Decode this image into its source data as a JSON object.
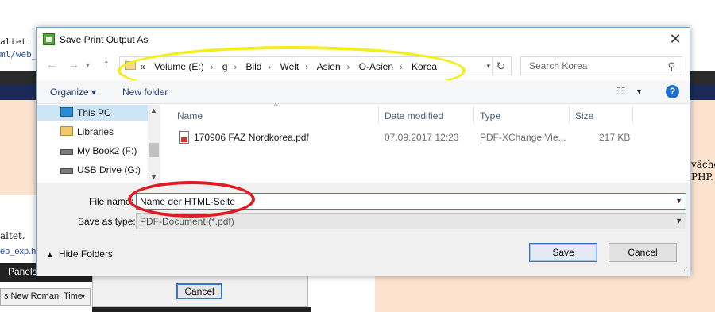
{
  "background": {
    "code_line1": "altet.",
    "code_line2": "ml/web_",
    "right_text1": "väche",
    "right_text2": "PHP.",
    "left_text1": "altet.",
    "left_text2": "eb_exp.ht",
    "panels_label": "Panels",
    "font_value": "s New Roman, Time",
    "cancel_label": "Cancel"
  },
  "dialog": {
    "title": "Save Print Output As",
    "close_glyph": "✕",
    "address": {
      "crumbs": [
        "«",
        "Volume (E:)",
        "g",
        "Bild",
        "Welt",
        "Asien",
        "O-Asien",
        "Korea"
      ]
    },
    "search": {
      "placeholder": "Search Korea"
    },
    "toolbar": {
      "organize": "Organize ▾",
      "new_folder": "New folder",
      "help": "?"
    },
    "nav_pane": {
      "items": [
        {
          "label": "This PC",
          "icon": "computer-icon"
        },
        {
          "label": "Libraries",
          "icon": "library-icon"
        },
        {
          "label": "My Book2 (F:)",
          "icon": "drive-icon"
        },
        {
          "label": "USB Drive (G:)",
          "icon": "usb-drive-icon"
        }
      ]
    },
    "file_list": {
      "columns": [
        "Name",
        "Date modified",
        "Type",
        "Size"
      ],
      "rows": [
        {
          "name": "170906 FAZ Nordkorea.pdf",
          "date": "07.09.2017 12:23",
          "type": "PDF-XChange Vie...",
          "size": "217 KB",
          "icon": "pdf-file-icon"
        }
      ]
    },
    "file_name": {
      "label": "File name:",
      "value": "Name der HTML-Seite"
    },
    "save_as_type": {
      "label": "Save as type:",
      "value": "PDF-Document (*.pdf)"
    },
    "hide_folders": "Hide Folders",
    "save_button": "Save",
    "cancel_button": "Cancel"
  },
  "annotations": {
    "highlight_colors": {
      "yellow": "#f2ef1d",
      "red": "#e01b22"
    }
  }
}
